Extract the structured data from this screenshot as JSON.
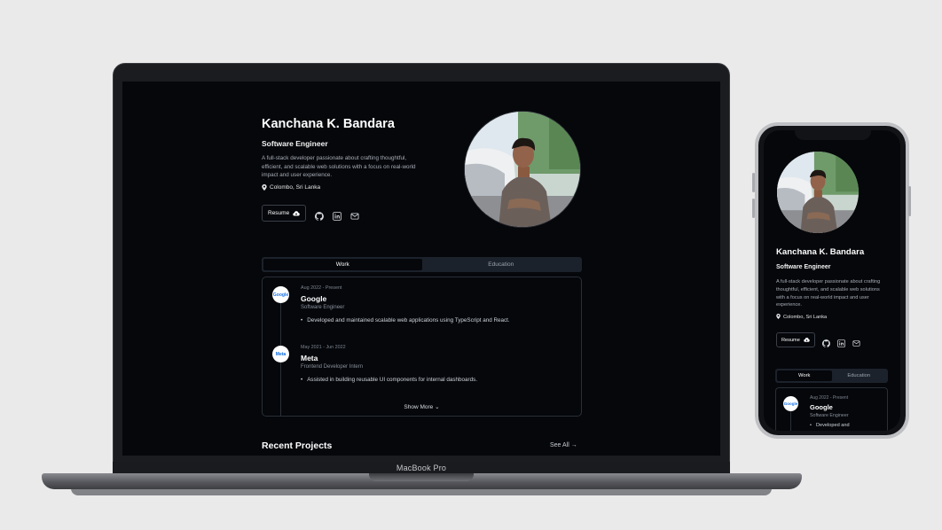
{
  "device_label": "MacBook Pro",
  "profile": {
    "name": "Kanchana K. Bandara",
    "role": "Software Engineer",
    "bio": "A full-stack developer passionate about crafting thoughtful, efficient, and scalable web solutions with a focus on real-world impact and user experience.",
    "location": "Colombo, Sri Lanka",
    "resume_label": "Resume"
  },
  "icons": [
    "map-pin-icon",
    "cloud-download-icon",
    "github-icon",
    "linkedin-icon",
    "mail-icon",
    "chevron-down-icon",
    "arrow-right-icon"
  ],
  "tabs": [
    {
      "label": "Work",
      "active": true
    },
    {
      "label": "Education",
      "active": false
    }
  ],
  "experience": [
    {
      "date": "Aug 2022 - Present",
      "company": "Google",
      "role": "Software Engineer",
      "logo_text": "Google",
      "bullet": "Developed and maintained scalable web applications using TypeScript and React."
    },
    {
      "date": "May 2021 - Jun 2022",
      "company": "Meta",
      "role": "Frontend Developer Intern",
      "logo_text": "Meta",
      "bullet": "Assisted in building reusable UI components for internal dashboards."
    }
  ],
  "show_more_label": "Show More",
  "recent_projects_title": "Recent Projects",
  "see_all_label": "See All",
  "mobile": {
    "bullet_partial": "Developed and"
  },
  "colors": {
    "background": "#05070b",
    "card_border": "#2a2f38",
    "tab_bg": "#1c222b",
    "text_primary": "#ffffff",
    "text_muted": "#a9adb6"
  }
}
